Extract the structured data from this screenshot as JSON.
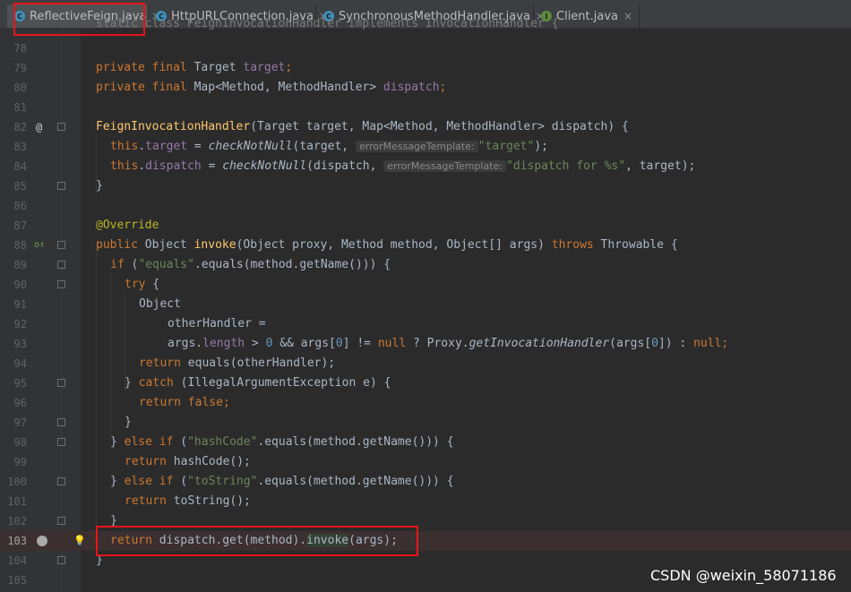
{
  "tabs": [
    {
      "label": "ReflectiveFeign.java",
      "icon": "class-icon",
      "icon_glyph": "C"
    },
    {
      "label": "HttpURLConnection.java",
      "icon": "class-icon",
      "icon_glyph": "C"
    },
    {
      "label": "SynchronousMethodHandler.java",
      "icon": "class-icon",
      "icon_glyph": "C"
    },
    {
      "label": "Client.java",
      "icon": "interface-icon",
      "icon_glyph": "I"
    }
  ],
  "tab_close_glyph": "×",
  "header_snippet": "static class FeignInvocationHandler implements InvocationHandler {",
  "lines": [
    {
      "n": "78"
    },
    {
      "n": "79"
    },
    {
      "n": "80"
    },
    {
      "n": "81"
    },
    {
      "n": "82"
    },
    {
      "n": "83"
    },
    {
      "n": "84"
    },
    {
      "n": "85"
    },
    {
      "n": "86"
    },
    {
      "n": "87"
    },
    {
      "n": "88"
    },
    {
      "n": "89"
    },
    {
      "n": "90"
    },
    {
      "n": "91"
    },
    {
      "n": "92"
    },
    {
      "n": "93"
    },
    {
      "n": "94"
    },
    {
      "n": "95"
    },
    {
      "n": "96"
    },
    {
      "n": "97"
    },
    {
      "n": "98"
    },
    {
      "n": "99"
    },
    {
      "n": "100"
    },
    {
      "n": "101"
    },
    {
      "n": "102"
    },
    {
      "n": "103"
    },
    {
      "n": "104"
    },
    {
      "n": "105"
    }
  ],
  "tokens": {
    "private": "private",
    "final": "final",
    "Target": "Target ",
    "target": "target",
    ";": ";",
    "Map": "Map<Method, MethodHandler> ",
    "dispatch": "dispatch",
    "ctor": "FeignInvocationHandler",
    "ctor_params": "(Target target, Map<Method, MethodHandler> dispatch) {",
    "this": "this",
    ".": ".",
    "eq": " = ",
    "checkNotNull": "checkNotNull",
    "hint": "errorMessageTemplate:",
    "l83_args": "(target, ",
    "l83_str": "\"target\"",
    "l83_end": ");",
    "l84_args": "(dispatch, ",
    "l84_str": "\"dispatch for %s\"",
    "l84_end": ", target);",
    "close": "}",
    "override": "@Override",
    "public": "public",
    "Object": "Object ",
    "invoke": "invoke",
    "invoke_params": "(Object proxy, Method method, Object[] args) ",
    "throws": "throws",
    "throwable": " Throwable {",
    "if": "if",
    "else": "else",
    "lp": " (",
    "equals_str": "\"equals\"",
    "hashcode_str": "\"hashCode\"",
    "tostring_str": "\"toString\"",
    "eq_call": ".equals(method.getName())) {",
    "try": "try",
    "try_open": " {",
    "obj": "Object",
    "otherHandler": "otherHandler =",
    "args": "args.",
    "length": "length",
    " > ": " > ",
    "0": "0",
    " && args[": " && args[",
    "]": "]",
    " != ": " != ",
    "null": "null",
    " ? Proxy.": " ? Proxy.",
    "getIH": "getInvocationHandler",
    "(args[": "(args[",
    "]) : ": "]) : ",
    "return": "return",
    "equals_call": " equals(otherHandler);",
    "catch_pre": "} ",
    "catch": "catch",
    "catch_rest": " (IllegalArgumentException e) {",
    "false": "false",
    "brace_sp": "} ",
    "hashCode_call": " hashCode();",
    "toString_call": " toString();",
    "l103a": " dispatch.get(method).",
    "l103b": "(args);"
  },
  "watermark": "CSDN @weixin_58071186",
  "gutter_icons": {
    "l82": "@",
    "l88": "o↑",
    "lightbulb": "💡"
  },
  "colors": {
    "keyword": "#cc7832",
    "field": "#9876aa",
    "string": "#6a8759",
    "number": "#6897bb",
    "annotation": "#bbb529",
    "method": "#ffc66d",
    "text": "#a9b7c6",
    "highlight_box": "#e8141a"
  }
}
